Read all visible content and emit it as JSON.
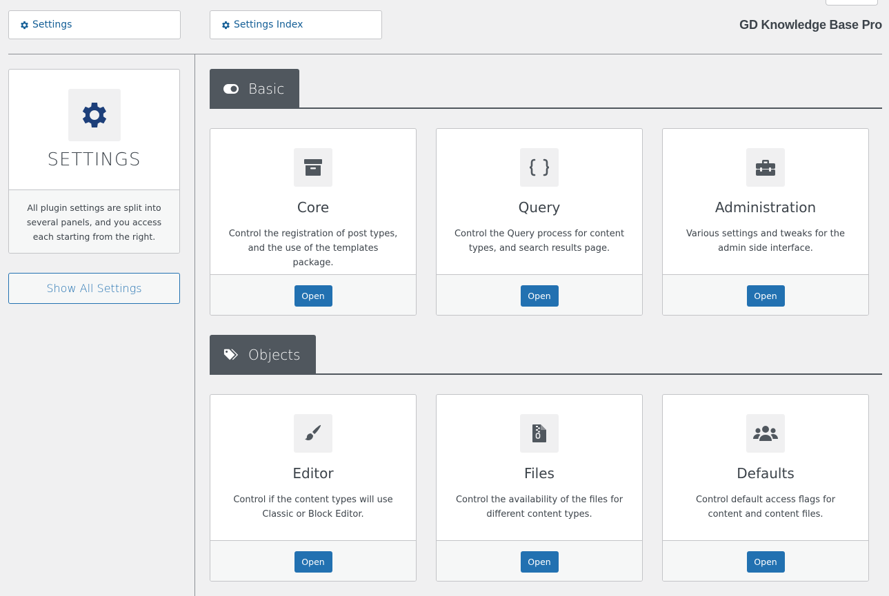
{
  "nav": {
    "settings_label": "Settings",
    "index_label": "Settings Index"
  },
  "brand": "GD Knowledge Base Pro",
  "sidebar": {
    "title": "SETTINGS",
    "description": "All plugin settings are split into several panels, and you access each starting from the right.",
    "show_all_label": "Show All Settings",
    "icon": "gear-icon"
  },
  "sections": [
    {
      "label": "Basic",
      "icon": "toggle-icon",
      "panels": [
        {
          "title": "Core",
          "description": "Control the registration of post types, and the use of the templates package.",
          "icon": "archive-icon",
          "button": "Open"
        },
        {
          "title": "Query",
          "description": "Control the Query process for content types, and search results page.",
          "icon": "braces-icon",
          "button": "Open"
        },
        {
          "title": "Administration",
          "description": "Various settings and tweaks for the admin side interface.",
          "icon": "toolbox-icon",
          "button": "Open"
        }
      ]
    },
    {
      "label": "Objects",
      "icon": "tags-icon",
      "panels": [
        {
          "title": "Editor",
          "description": "Control if the content types will use Classic or Block Editor.",
          "icon": "paintbrush-icon",
          "button": "Open"
        },
        {
          "title": "Files",
          "description": "Control the availability of the files for different content types.",
          "icon": "file-zipper-icon",
          "button": "Open"
        },
        {
          "title": "Defaults",
          "description": "Control default access flags for content and content files.",
          "icon": "users-icon",
          "button": "Open"
        }
      ]
    }
  ],
  "colors": {
    "accent": "#2271b1",
    "gear_blue": "#1d3f7a",
    "tab_bg": "#50575e",
    "page_bg": "#f0f0f1"
  }
}
